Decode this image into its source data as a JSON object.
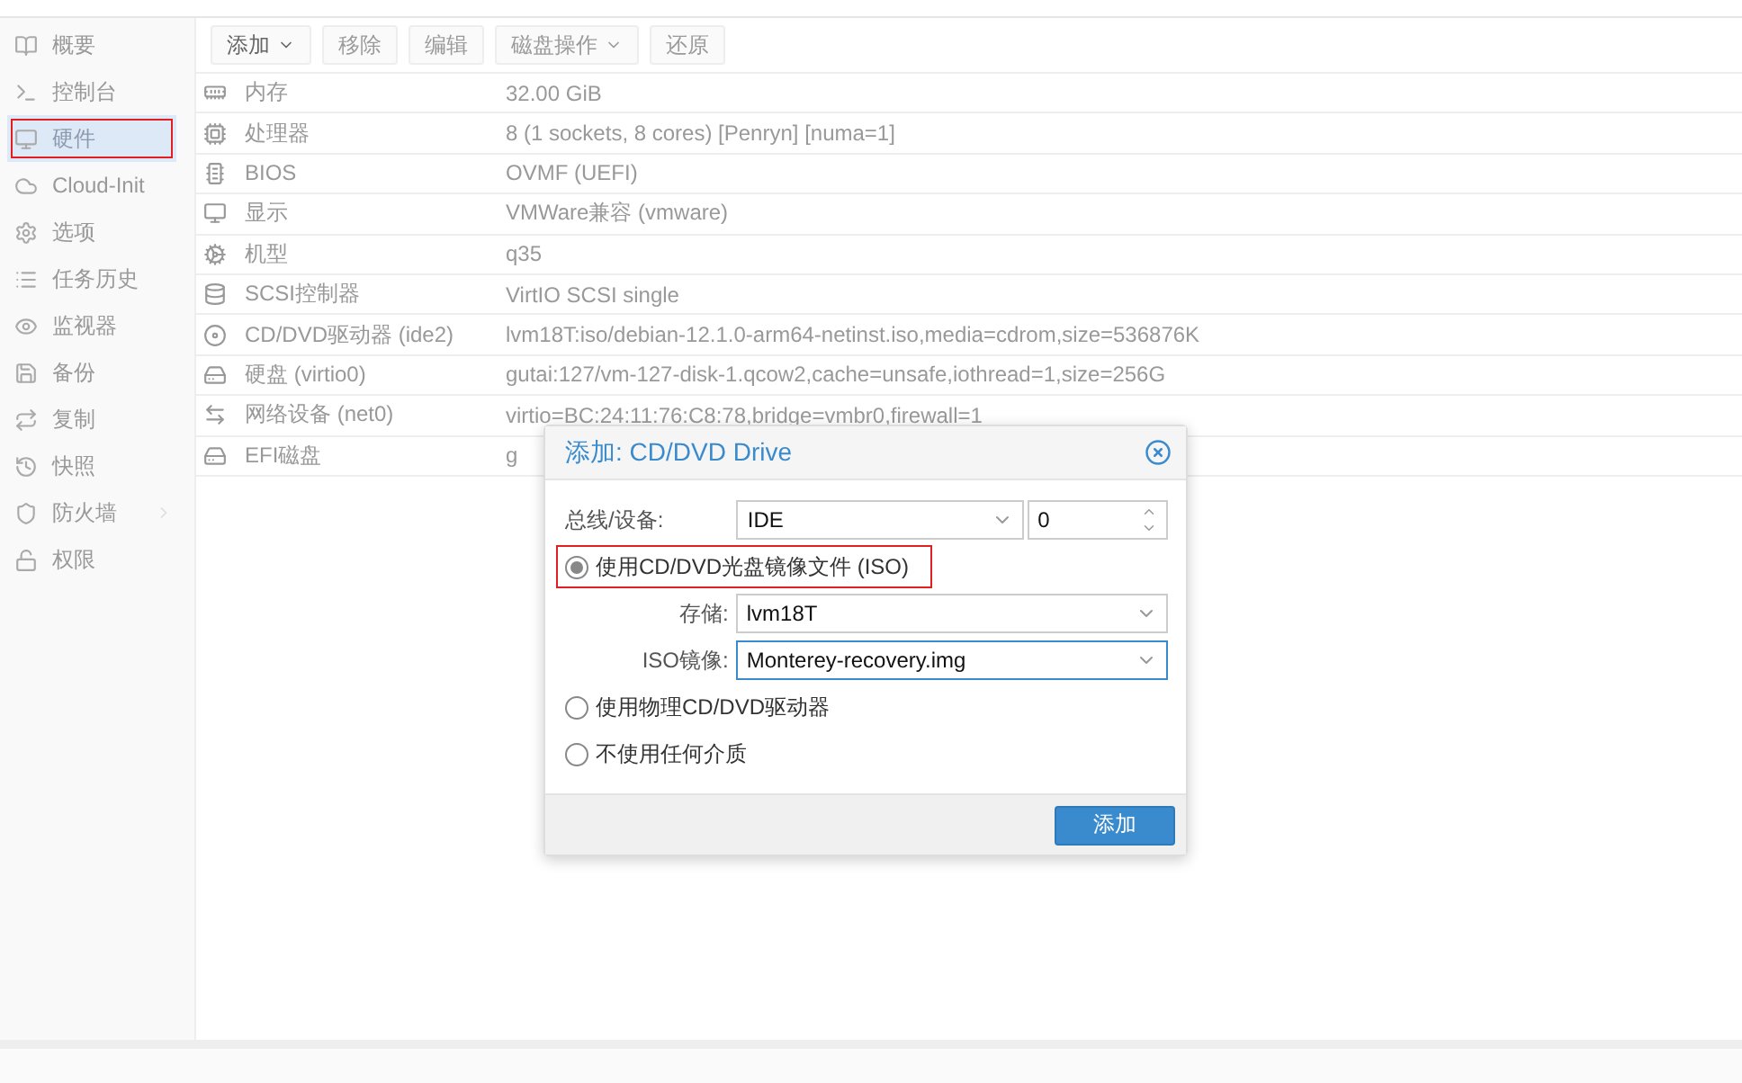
{
  "sidebar": {
    "items": [
      {
        "label": "概要",
        "selected": false,
        "highlighted": false,
        "expandable": false
      },
      {
        "label": "控制台",
        "selected": false,
        "highlighted": false,
        "expandable": false
      },
      {
        "label": "硬件",
        "selected": true,
        "highlighted": true,
        "expandable": false
      },
      {
        "label": "Cloud-Init",
        "selected": false,
        "highlighted": false,
        "expandable": false
      },
      {
        "label": "选项",
        "selected": false,
        "highlighted": false,
        "expandable": false
      },
      {
        "label": "任务历史",
        "selected": false,
        "highlighted": false,
        "expandable": false
      },
      {
        "label": "监视器",
        "selected": false,
        "highlighted": false,
        "expandable": false
      },
      {
        "label": "备份",
        "selected": false,
        "highlighted": false,
        "expandable": false
      },
      {
        "label": "复制",
        "selected": false,
        "highlighted": false,
        "expandable": false
      },
      {
        "label": "快照",
        "selected": false,
        "highlighted": false,
        "expandable": false
      },
      {
        "label": "防火墙",
        "selected": false,
        "highlighted": false,
        "expandable": true
      },
      {
        "label": "权限",
        "selected": false,
        "highlighted": false,
        "expandable": false
      }
    ]
  },
  "toolbar": [
    {
      "label": "添加",
      "dropdown": true,
      "disabled": false
    },
    {
      "label": "移除",
      "dropdown": false,
      "disabled": true
    },
    {
      "label": "编辑",
      "dropdown": false,
      "disabled": true
    },
    {
      "label": "磁盘操作",
      "dropdown": true,
      "disabled": true
    },
    {
      "label": "还原",
      "dropdown": false,
      "disabled": true
    }
  ],
  "hardware": [
    {
      "name": "内存",
      "value": "32.00 GiB",
      "selected": false
    },
    {
      "name": "处理器",
      "value": "8 (1 sockets, 8 cores) [Penryn] [numa=1]",
      "selected": false
    },
    {
      "name": "BIOS",
      "value": "OVMF (UEFI)",
      "selected": false
    },
    {
      "name": "显示",
      "value": "VMWare兼容 (vmware)",
      "selected": false
    },
    {
      "name": "机型",
      "value": "q35",
      "selected": false
    },
    {
      "name": "SCSI控制器",
      "value": "VirtIO SCSI single",
      "selected": false
    },
    {
      "name": "CD/DVD驱动器 (ide2)",
      "value": "lvm18T:iso/debian-12.1.0-arm64-netinst.iso,media=cdrom,size=536876K",
      "selected": false
    },
    {
      "name": "硬盘 (virtio0)",
      "value": "gutai:127/vm-127-disk-1.qcow2,cache=unsafe,iothread=1,size=256G",
      "selected": false
    },
    {
      "name": "网络设备 (net0)",
      "value": "virtio=BC:24:11:76:C8:78,bridge=vmbr0,firewall=1",
      "selected": false
    },
    {
      "name": "EFI磁盘",
      "value": "g",
      "selected": false
    }
  ],
  "dialog": {
    "title": "添加: CD/DVD Drive",
    "bus_label": "总线/设备:",
    "bus_value": "IDE",
    "device_value": "0",
    "options": [
      {
        "label": "使用CD/DVD光盘镜像文件 (ISO)",
        "selected": true,
        "highlighted": true
      },
      {
        "label": "使用物理CD/DVD驱动器",
        "selected": false,
        "highlighted": false
      },
      {
        "label": "不使用任何介质",
        "selected": false,
        "highlighted": false
      }
    ],
    "storage_label": "存储:",
    "storage_value": "lvm18T",
    "iso_label": "ISO镜像:",
    "iso_value": "Monterey-recovery.img",
    "button": "添加"
  }
}
